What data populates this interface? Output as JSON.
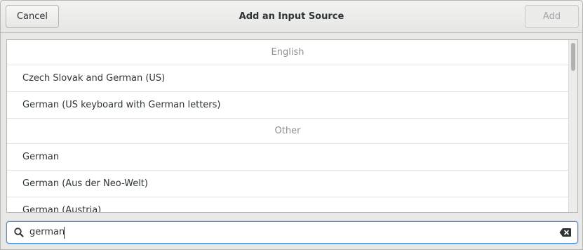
{
  "window": {
    "title": "Add an Input Source"
  },
  "header": {
    "cancel_label": "Cancel",
    "add_label": "Add"
  },
  "list": {
    "groups": [
      {
        "heading": "English",
        "items": [
          "Czech Slovak and German (US)",
          "German (US keyboard with German letters)"
        ]
      },
      {
        "heading": "Other",
        "items": [
          "German",
          "German (Aus der Neo-Welt)",
          "German (Austria)"
        ]
      }
    ]
  },
  "search": {
    "value": "german"
  },
  "icons": {
    "search": "search-icon",
    "clear": "clear-icon"
  },
  "colors": {
    "accent": "#4a90d9",
    "section_heading": "#8d9091",
    "disabled_text": "#a3a6a6"
  }
}
